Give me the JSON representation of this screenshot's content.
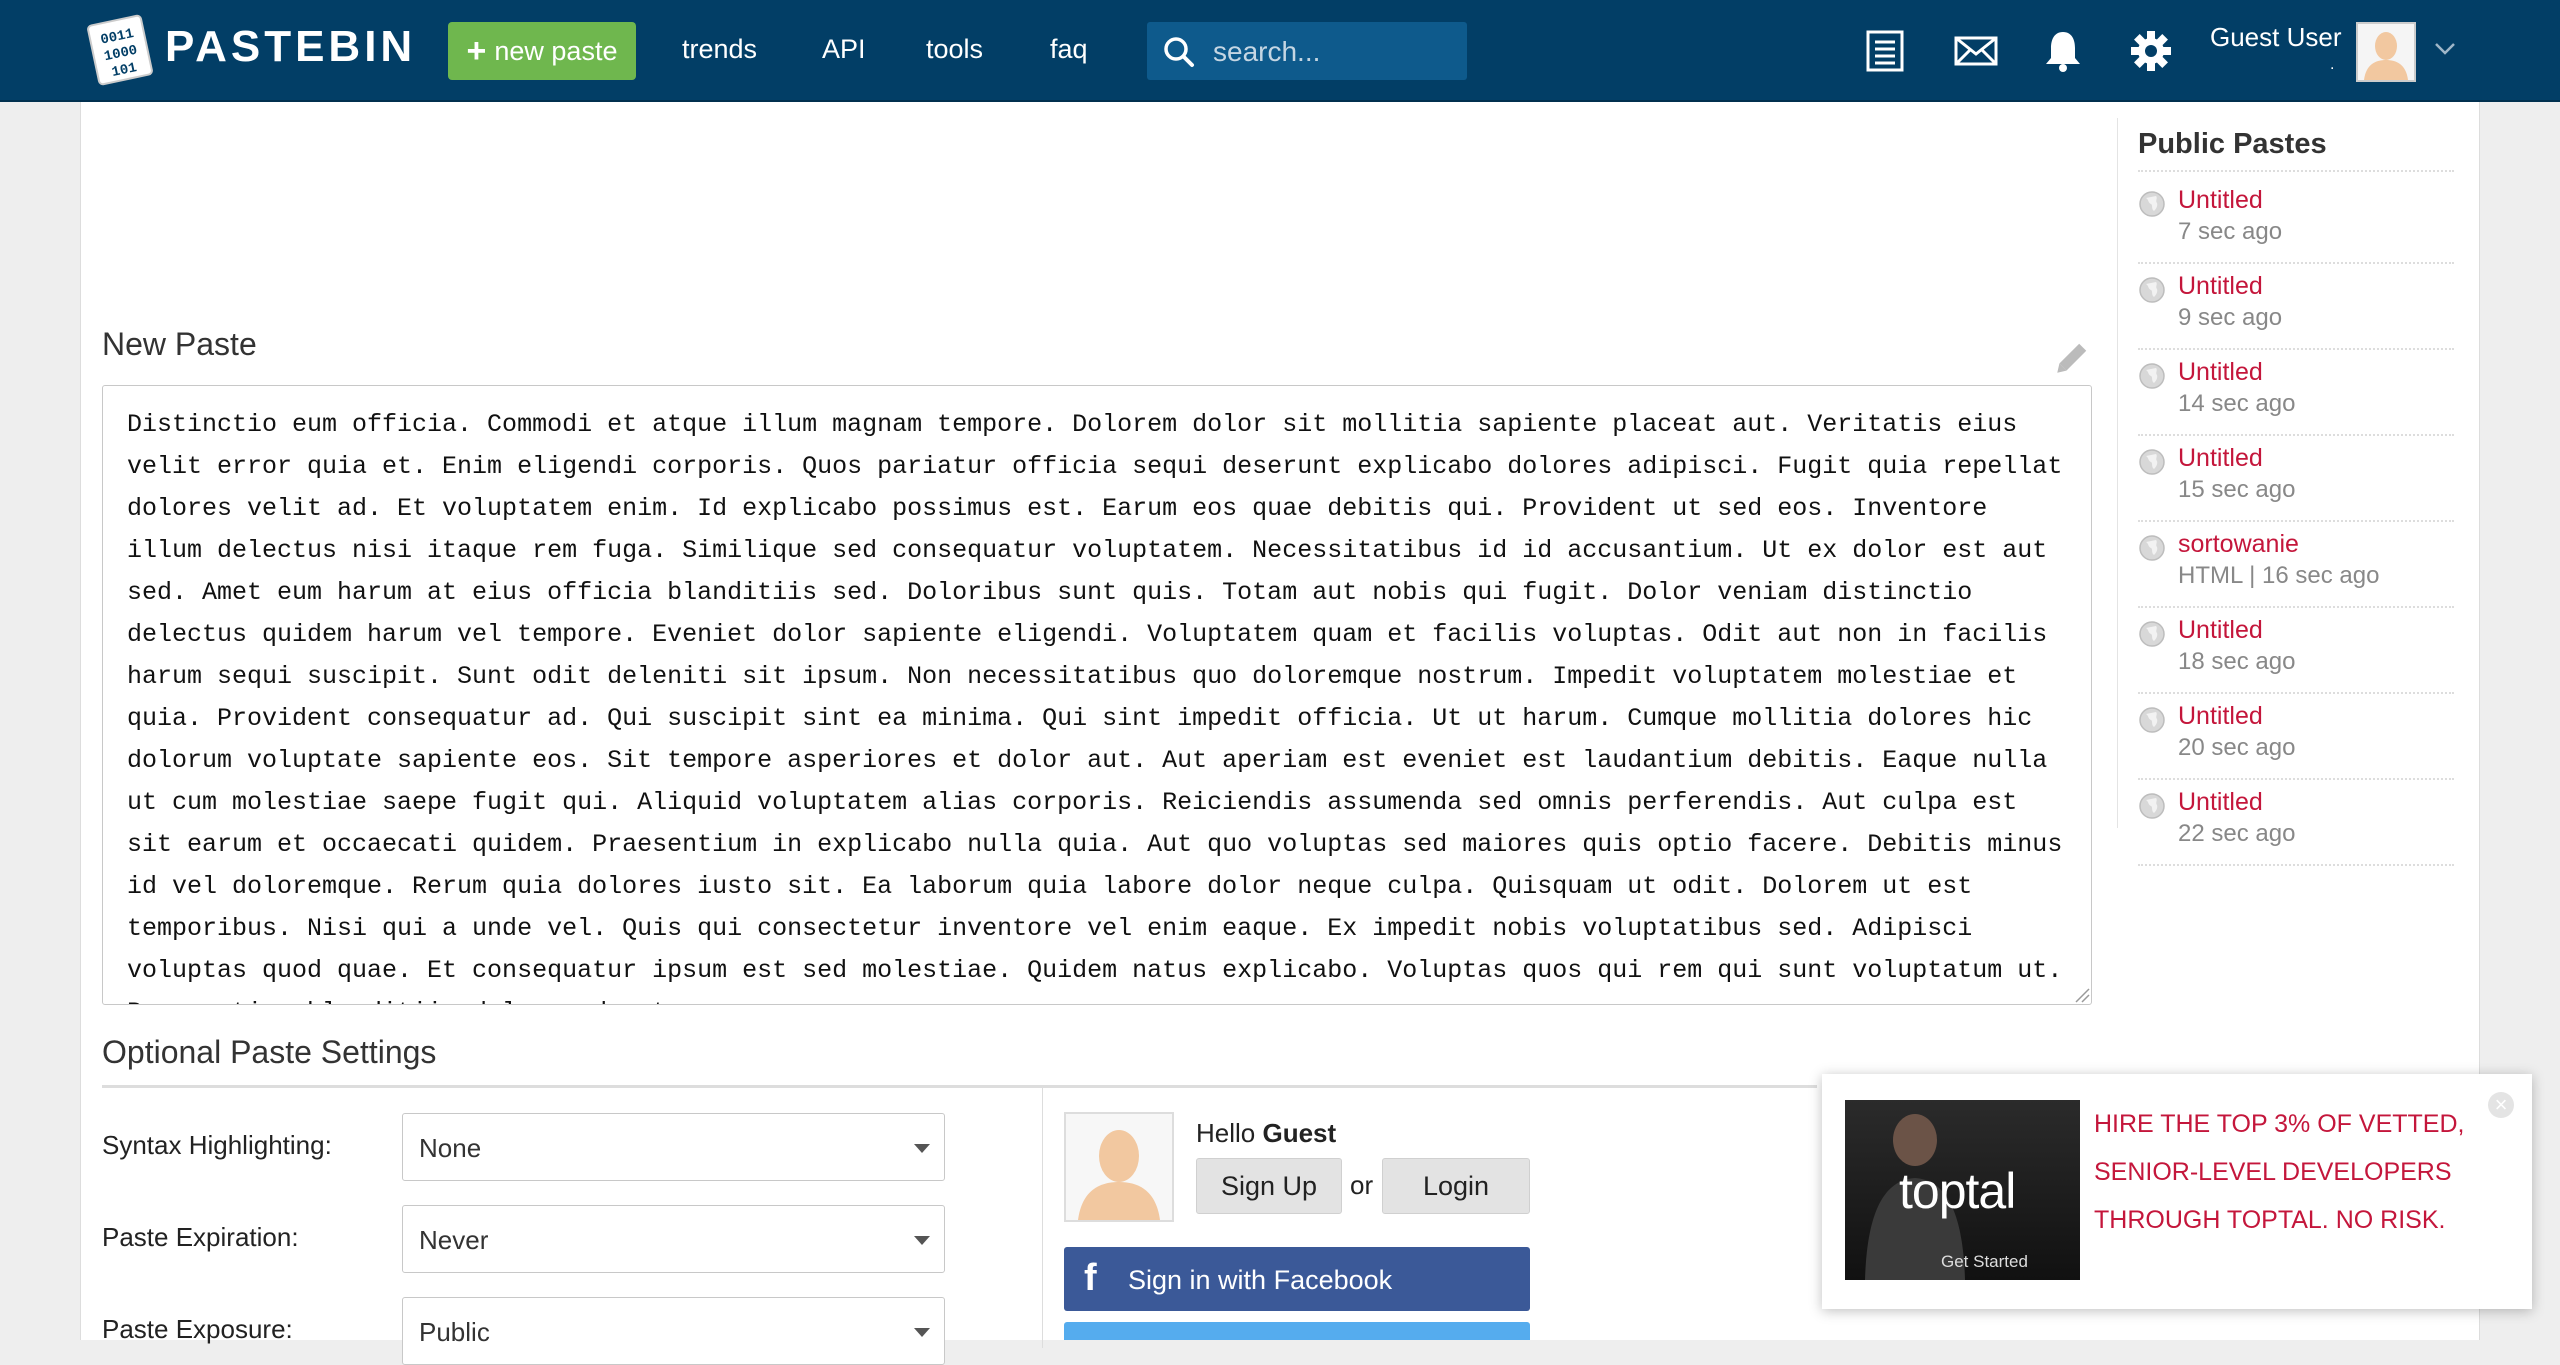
{
  "header": {
    "brand": "PASTEBIN",
    "new_paste_label": "new paste",
    "nav": [
      "trends",
      "API",
      "tools",
      "faq"
    ],
    "search_placeholder": "search...",
    "user_name": "Guest User",
    "icons": [
      "list-icon",
      "mail-icon",
      "bell-icon",
      "gear-icon",
      "chevron-down-icon"
    ]
  },
  "editor": {
    "heading": "New Paste",
    "content": "Distinctio eum officia. Commodi et atque illum magnam tempore. Dolorem dolor sit mollitia sapiente placeat aut. Veritatis eius velit error quia et. Enim eligendi corporis. Quos pariatur officia sequi deserunt explicabo dolores adipisci. Fugit quia repellat dolores velit ad. Et voluptatem enim. Id explicabo possimus est. Earum eos quae debitis qui. Provident ut sed eos. Inventore illum delectus nisi itaque rem fuga. Similique sed consequatur voluptatem. Necessitatibus id id accusantium. Ut ex dolor est aut sed. Amet eum harum at eius officia blanditiis sed. Doloribus sunt quis. Totam aut nobis qui fugit. Dolor veniam distinctio delectus quidem harum vel tempore. Eveniet dolor sapiente eligendi. Voluptatem quam et facilis voluptas. Odit aut non in facilis harum sequi suscipit. Sunt odit deleniti sit ipsum. Non necessitatibus quo doloremque nostrum. Impedit voluptatem molestiae et quia. Provident consequatur ad. Qui suscipit sint ea minima. Qui sint impedit officia. Ut ut harum. Cumque mollitia dolores hic dolorum voluptate sapiente eos. Sit tempore asperiores et dolor aut. Aut aperiam est eveniet est laudantium debitis. Eaque nulla ut cum molestiae saepe fugit qui. Aliquid voluptatem alias corporis. Reiciendis assumenda sed omnis perferendis. Aut culpa est sit earum et occaecati quidem. Praesentium in explicabo nulla quia. Aut quo voluptas sed maiores quis optio facere. Debitis minus id vel doloremque. Rerum quia dolores iusto sit. Ea laborum quia labore dolor neque culpa. Quisquam ut odit. Dolorem ut est temporibus. Nisi qui a unde vel. Quis qui consectetur inventore vel enim eaque. Ex impedit nobis voluptatibus sed. Adipisci voluptas quod quae. Et consequatur ipsum est sed molestiae. Quidem natus explicabo. Voluptas quos qui rem qui sunt voluptatum ut. Praesentium blanditiis dolor sed est."
  },
  "settings": {
    "heading": "Optional Paste Settings",
    "rows": [
      {
        "label": "Syntax Highlighting:",
        "value": "None"
      },
      {
        "label": "Paste Expiration:",
        "value": "Never"
      },
      {
        "label": "Paste Exposure:",
        "value": "Public"
      }
    ]
  },
  "guest": {
    "hello": "Hello",
    "name": "Guest",
    "signup_label": "Sign Up",
    "or_label": "or",
    "login_label": "Login",
    "facebook_label": "Sign in with Facebook"
  },
  "sidebar": {
    "title": "Public Pastes",
    "items": [
      {
        "title": "Untitled",
        "meta": "7 sec ago"
      },
      {
        "title": "Untitled",
        "meta": "9 sec ago"
      },
      {
        "title": "Untitled",
        "meta": "14 sec ago"
      },
      {
        "title": "Untitled",
        "meta": "15 sec ago"
      },
      {
        "title": "sortowanie",
        "meta": "HTML | 16 sec ago"
      },
      {
        "title": "Untitled",
        "meta": "18 sec ago"
      },
      {
        "title": "Untitled",
        "meta": "20 sec ago"
      },
      {
        "title": "Untitled",
        "meta": "22 sec ago"
      }
    ]
  },
  "ad": {
    "brand": "toptal",
    "cta": "Get Started",
    "lines": [
      "HIRE THE TOP 3% OF VETTED,",
      "SENIOR-LEVEL DEVELOPERS",
      "THROUGH TOPTAL. NO RISK."
    ]
  },
  "colors": {
    "header_bg": "#023e66",
    "new_paste_green": "#6fb74e",
    "link_red": "#c4163b",
    "facebook_blue": "#3b5998"
  }
}
